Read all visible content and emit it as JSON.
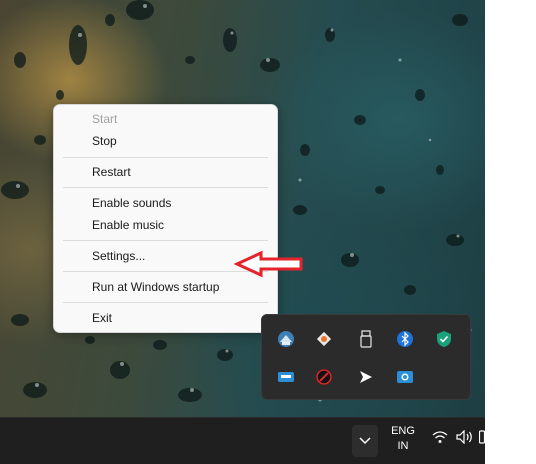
{
  "menu": {
    "items": [
      {
        "label": "Start",
        "enabled": false
      },
      {
        "label": "Stop",
        "enabled": true
      },
      {
        "label": "Restart",
        "enabled": true
      },
      {
        "label": "Enable sounds",
        "enabled": true
      },
      {
        "label": "Enable music",
        "enabled": true
      },
      {
        "label": "Settings...",
        "enabled": true
      },
      {
        "label": "Run at Windows startup",
        "enabled": true
      },
      {
        "label": "Exit",
        "enabled": true
      }
    ]
  },
  "tray_flyout": {
    "icons": [
      "app-tray-icon",
      "app-diamond-tray-icon",
      "usb-drive-icon",
      "bluetooth-icon",
      "security-shield-icon",
      "storage-tray-icon",
      "red-circle-tray-icon",
      "cursor-arrow-tray-icon",
      "camera-tray-icon"
    ]
  },
  "taskbar": {
    "language_line1": "ENG",
    "language_line2": "IN",
    "system_icons": [
      "wifi-icon",
      "volume-icon",
      "battery-icon"
    ]
  },
  "colors": {
    "annotation_arrow": "#e5232a",
    "bluetooth": "#1e73d8",
    "shield": "#1aa37a",
    "menu_background": "#f9f9f9",
    "taskbar": "#1f1f1f"
  }
}
